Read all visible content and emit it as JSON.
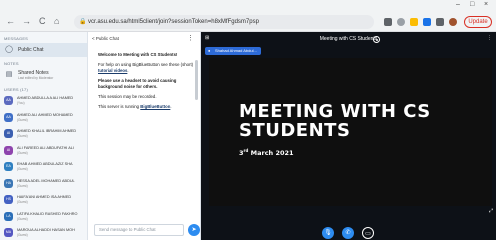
{
  "window": {
    "minimize": "–",
    "maximize": "□",
    "close": "×"
  },
  "browser": {
    "back": "←",
    "forward": "→",
    "reload": "C",
    "home": "⌂",
    "url": "vcr.asu.edu.sa/html5client/join?sessionToken=h8xMfFgdsm7psp",
    "update_label": "Update"
  },
  "sidebar": {
    "messages_title": "MESSAGES",
    "public_chat": "Public Chat",
    "notes_title": "NOTES",
    "shared_notes": "Shared Notes",
    "shared_notes_sub": "Last edited by Moderator",
    "users_title": "USERS (17)",
    "users": [
      {
        "initials": "AA",
        "name": "AHMED ABDULLA A ALI HAMED",
        "status": "(You)",
        "color": "#5b6abf"
      },
      {
        "initials": "AA",
        "name": "AHMED ALI AHMED MOHAMED",
        "status": "(Guest)",
        "color": "#3f6fc7"
      },
      {
        "initials": "AI",
        "name": "AHMED KHALIL IBRAHIM AHMED",
        "status": "(Guest)",
        "color": "#3b5fb0"
      },
      {
        "initials": "AI",
        "name": "ALI FAREED ALI ABDUFATHI ALI",
        "status": "(Guest)",
        "color": "#8e44ad"
      },
      {
        "initials": "EA",
        "name": "EHAB AHMED ABDULAZIZ SHA",
        "status": "(Guest)",
        "color": "#2f80c1"
      },
      {
        "initials": "HA",
        "name": "HESSA ADEL MOHAMED ABDUL",
        "status": "(Guest)",
        "color": "#3b76b5"
      },
      {
        "initials": "HS",
        "name": "HAIFA'ANI AHMED ISA AHMED",
        "status": "(Guest)",
        "color": "#4361c2"
      },
      {
        "initials": "LA",
        "name": "LATIFA KHALID RASHED FAKHRO",
        "status": "(Guest)",
        "color": "#2b6fb8"
      },
      {
        "initials": "MA",
        "name": "MAROUA ALHADDI HASAN MOH",
        "status": "(Guest)",
        "color": "#5558c2"
      }
    ]
  },
  "chat": {
    "back_label": "< Public Chat",
    "menu": "⋮",
    "welcome_title": "Welcome to Meeting with CS Students!",
    "help_text": "For help on using BigBlueButton see these (short)",
    "help_link": "tutorial videos",
    "headset_text": "Please use a headset to avoid causing background noise for others.",
    "recorded_text": "This session may be recorded.",
    "server_text": "This server is running",
    "server_link": "BigBlueButton",
    "input_placeholder": "Send message to Public Chat",
    "send_icon": "send-icon"
  },
  "meeting": {
    "title": "Meeting with CS Students",
    "talking_label": "Shahad Ahmad Abdul...",
    "slide_title_line1": "MEETING WITH CS",
    "slide_title_line2": "STUDENTS",
    "slide_date_day": "3",
    "slide_date_sup": "rd",
    "slide_date_rest": " March 2021"
  },
  "colors": {
    "accent": "#2d8cf0",
    "slide_bg": "#0f0f0f",
    "meeting_bg": "#0d1117"
  }
}
